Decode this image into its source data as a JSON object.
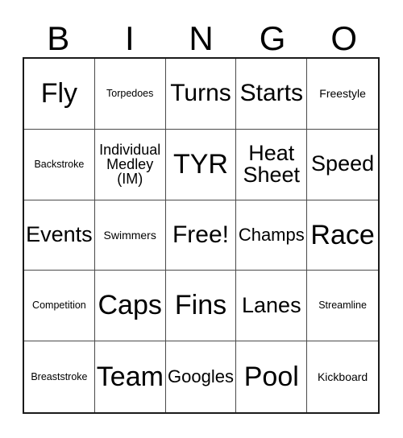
{
  "card": {
    "title": "BINGO",
    "header_letters": [
      "B",
      "I",
      "N",
      "G",
      "O"
    ],
    "border_color": "#1a1a1a",
    "grid_line_color": "#4a4a4a",
    "text_color": "#000000",
    "background_color": "#ffffff",
    "rows": 5,
    "columns": 5,
    "free_space": "Free!",
    "cells": [
      [
        {
          "label": "Fly",
          "size": "fs-xxl"
        },
        {
          "label": "Torpedoes",
          "size": "fs-xxs"
        },
        {
          "label": "Turns",
          "size": "fs-xl"
        },
        {
          "label": "Starts",
          "size": "fs-xl"
        },
        {
          "label": "Freestyle",
          "size": "fs-xs"
        }
      ],
      [
        {
          "label": "Backstroke",
          "size": "fs-xxs"
        },
        {
          "label": "Individual\nMedley\n(IM)",
          "size": "fs-s"
        },
        {
          "label": "TYR",
          "size": "fs-xxl"
        },
        {
          "label": "Heat\nSheet",
          "size": "fs-l"
        },
        {
          "label": "Speed",
          "size": "fs-l"
        }
      ],
      [
        {
          "label": "Events",
          "size": "fs-l"
        },
        {
          "label": "Swimmers",
          "size": "fs-xs"
        },
        {
          "label": "Free!",
          "size": "fs-xl"
        },
        {
          "label": "Champs",
          "size": "fs-m"
        },
        {
          "label": "Race",
          "size": "fs-xxl"
        }
      ],
      [
        {
          "label": "Competition",
          "size": "fs-xxs"
        },
        {
          "label": "Caps",
          "size": "fs-xxl"
        },
        {
          "label": "Fins",
          "size": "fs-xxl"
        },
        {
          "label": "Lanes",
          "size": "fs-l"
        },
        {
          "label": "Streamline",
          "size": "fs-xxs"
        }
      ],
      [
        {
          "label": "Breaststroke",
          "size": "fs-xxs"
        },
        {
          "label": "Team",
          "size": "fs-xxl"
        },
        {
          "label": "Googles",
          "size": "fs-m"
        },
        {
          "label": "Pool",
          "size": "fs-xxl"
        },
        {
          "label": "Kickboard",
          "size": "fs-xs"
        }
      ]
    ]
  }
}
